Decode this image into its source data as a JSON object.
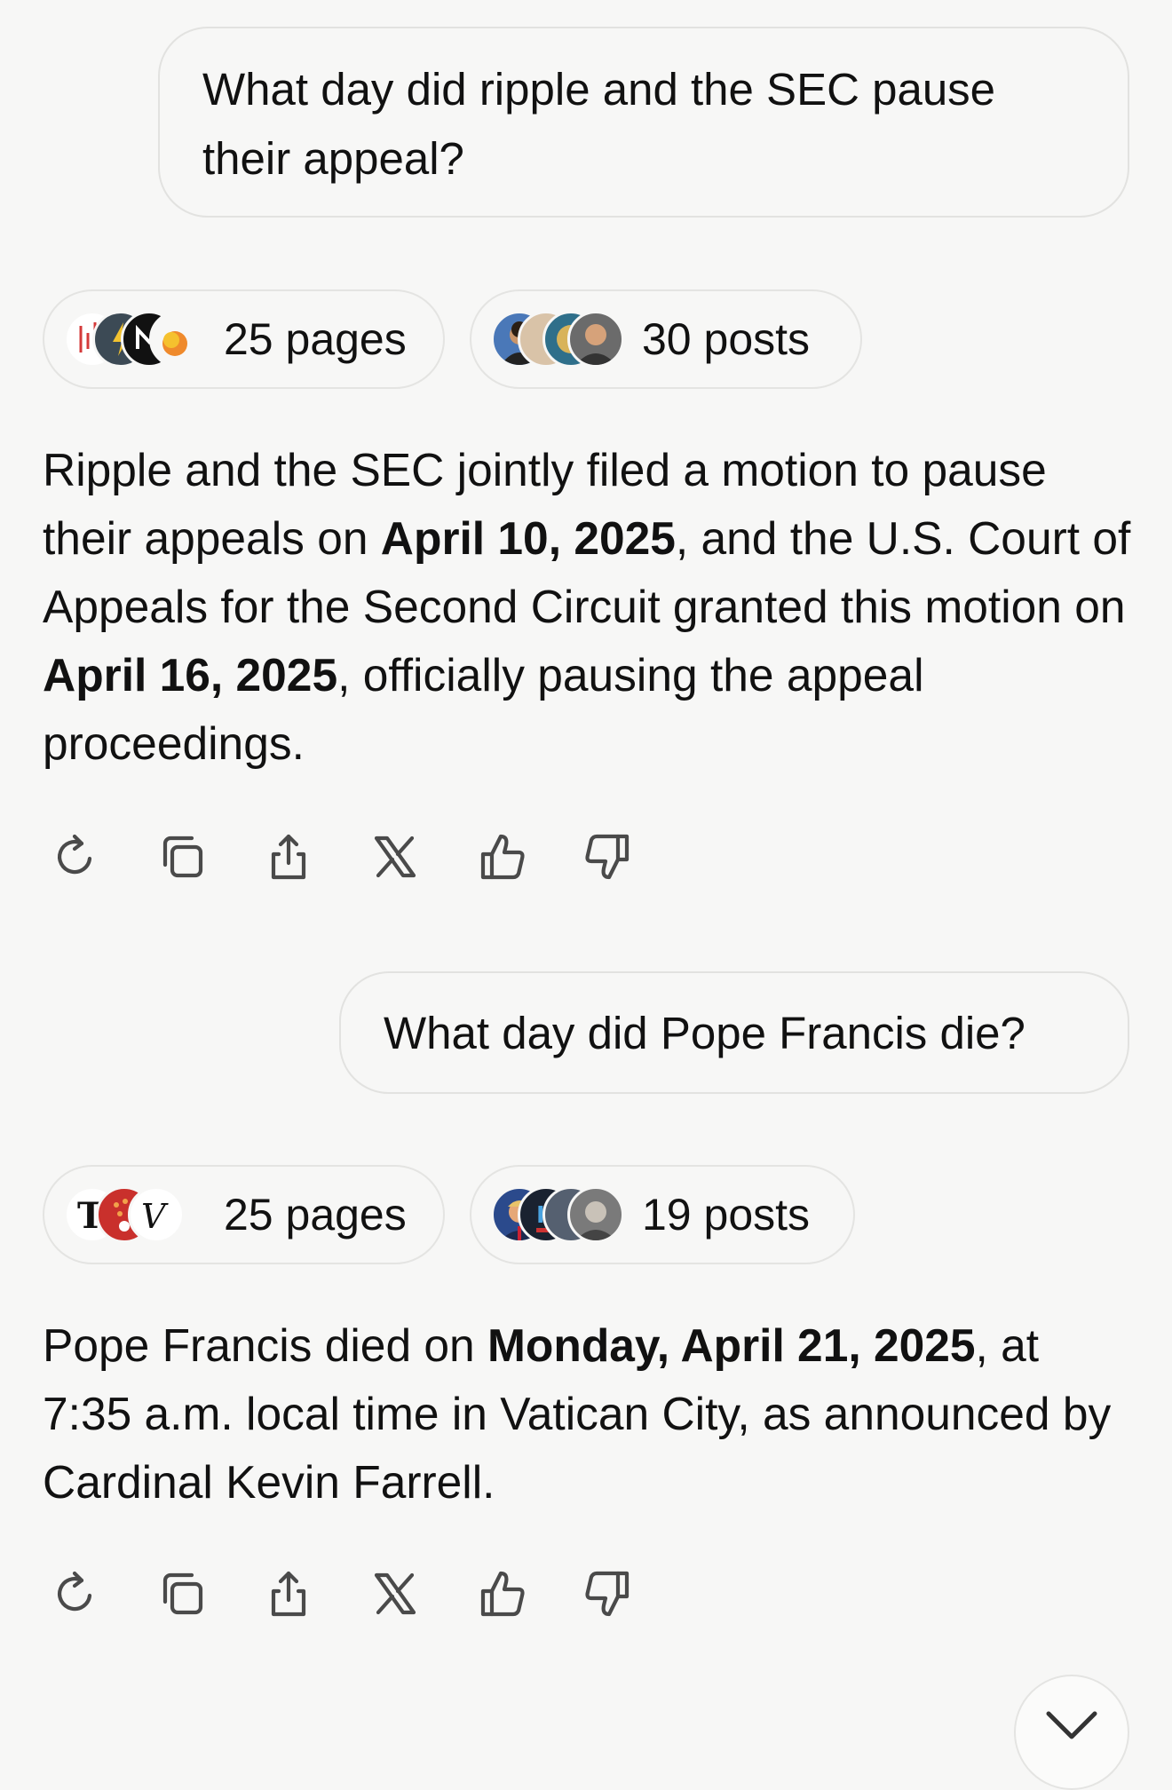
{
  "conversation": [
    {
      "question": "What day did ripple and the SEC pause their appeal?",
      "pages_chip": {
        "label": "25 pages",
        "icons": [
          "chart-logo",
          "lightning-logo",
          "m-logo",
          "flame-logo"
        ]
      },
      "posts_chip": {
        "label": "30 posts",
        "icons": [
          "user-avatar",
          "user-avatar",
          "coin-avatar",
          "user-avatar"
        ]
      },
      "answer": {
        "p1": "Ripple and the SEC jointly filed a motion to pause their appeals on ",
        "b1": "April 10, 2025",
        "p2": ", and the U.S. Court of Appeals for the Second Circuit granted this motion on ",
        "b2": "April 16, 2025",
        "p3": ", officially pausing the appeal proceedings."
      }
    },
    {
      "question": "What day did Pope Francis die?",
      "pages_chip": {
        "label": "25 pages",
        "icons": [
          "nyt-logo",
          "news-logo",
          "v-logo"
        ]
      },
      "posts_chip": {
        "label": "19 posts",
        "icons": [
          "user-avatar",
          "news-avatar",
          "user-avatar",
          "user-avatar"
        ]
      },
      "answer": {
        "p1": "Pope Francis died on ",
        "b1": "Monday, April 21, 2025",
        "p2": ", at 7:35 a.m. local time in Vatican City, as announced by Cardinal Kevin Farrell."
      }
    }
  ],
  "action_icons": [
    "regenerate-icon",
    "copy-icon",
    "share-icon",
    "x-logo-icon",
    "thumbs-up-icon",
    "thumbs-down-icon"
  ],
  "colors": {
    "background": "#f7f7f6",
    "border": "#e2e2e0",
    "icon": "#4a4a4a"
  }
}
